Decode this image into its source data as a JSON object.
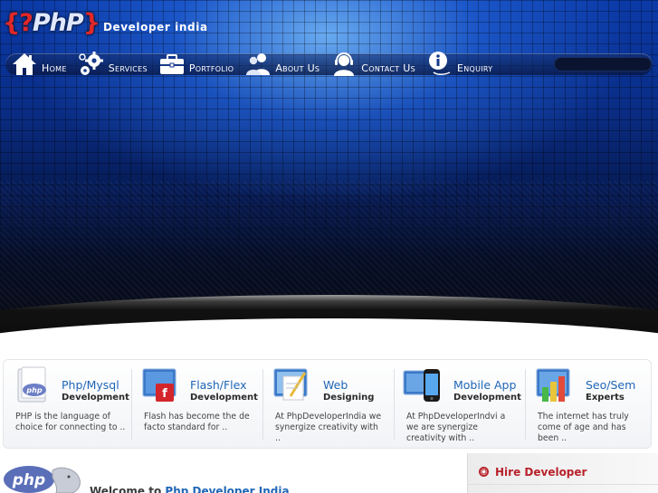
{
  "brand": {
    "logo_text": "PhP",
    "logo_prefix": "{?",
    "logo_suffix": "}",
    "tagline": "Developer india"
  },
  "nav": {
    "items": [
      {
        "label": "Home",
        "icon": "home-icon"
      },
      {
        "label": "Services",
        "icon": "gears-icon"
      },
      {
        "label": "Portfolio",
        "icon": "briefcase-icon"
      },
      {
        "label": "About Us",
        "icon": "people-icon"
      },
      {
        "label": "Contact Us",
        "icon": "headset-icon"
      },
      {
        "label": "Enquiry",
        "icon": "info-icon"
      }
    ]
  },
  "services": [
    {
      "title": "Php/Mysql",
      "subtitle": "Development",
      "desc": "PHP is the language of choice for connecting to ..",
      "icon": "php-box-icon"
    },
    {
      "title": "Flash/Flex",
      "subtitle": "Development",
      "desc": "Flash has become the de facto standard for ..",
      "icon": "flash-box-icon"
    },
    {
      "title": "Web",
      "subtitle": "Designing",
      "desc": "At PhpDeveloperIndia we synergize creativity with ..",
      "icon": "web-design-icon"
    },
    {
      "title": "Mobile App",
      "subtitle": "Development",
      "desc": "At PhpDeveloperIndvi a we are synergize creativity with ..",
      "icon": "mobile-icon"
    },
    {
      "title": "Seo/Sem",
      "subtitle": "Experts",
      "desc": "The internet has truly come of age and has been ..",
      "icon": "seo-chart-icon"
    }
  ],
  "welcome": {
    "prefix": "Welcome to",
    "highlight": "Php Developer India"
  },
  "sidebar": {
    "hire_label": "Hire Developer"
  },
  "colors": {
    "accent_blue": "#1f66b6",
    "hire_red": "#b8222c",
    "hero_blue": "#0b3aa8"
  }
}
